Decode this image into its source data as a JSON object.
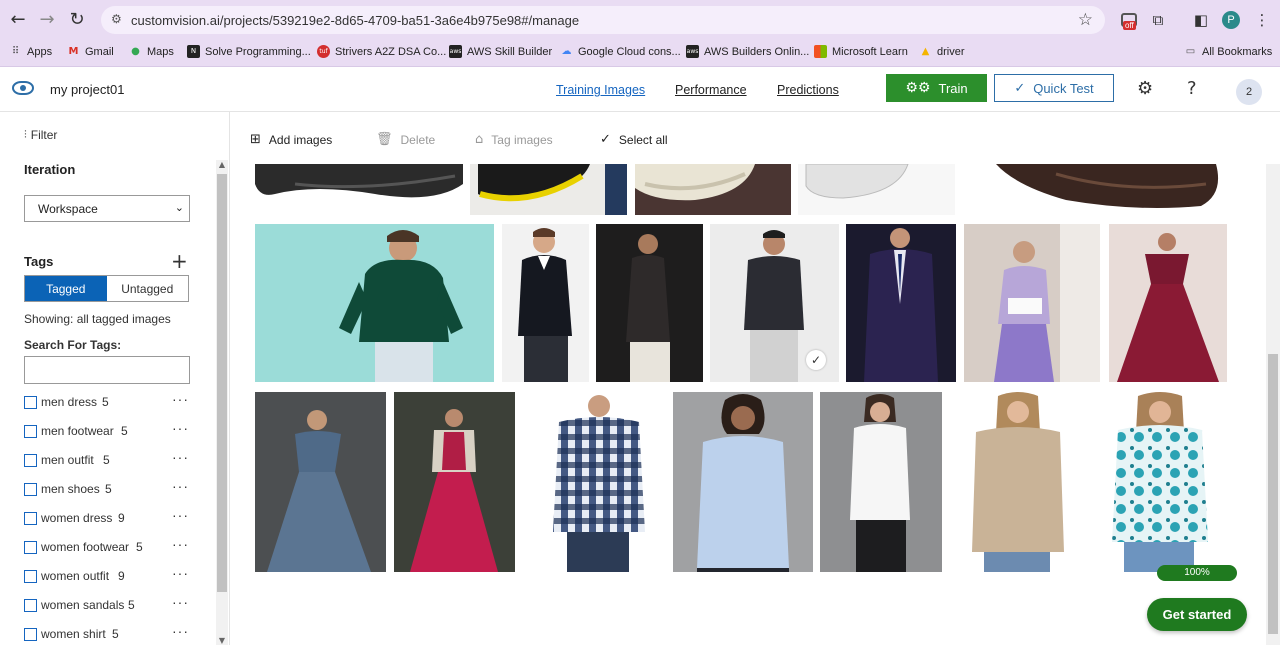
{
  "browser": {
    "url": "customvision.ai/projects/539219e2-8d65-4709-ba51-3a6e4b975e98#/manage",
    "profile_initial": "P",
    "extension_badge": "off",
    "bookmarks": [
      {
        "label": "Apps",
        "icon": "apps-grid-icon"
      },
      {
        "label": "Gmail",
        "icon": "gmail-icon"
      },
      {
        "label": "Maps",
        "icon": "maps-icon"
      },
      {
        "label": "Solve Programming...",
        "icon": "site-icon"
      },
      {
        "label": "Strivers A2Z DSA Co...",
        "icon": "site-icon"
      },
      {
        "label": "AWS Skill Builder",
        "icon": "aws-icon"
      },
      {
        "label": "Google Cloud cons...",
        "icon": "google-cloud-icon"
      },
      {
        "label": "AWS Builders Onlin...",
        "icon": "aws-icon"
      },
      {
        "label": "Microsoft Learn",
        "icon": "microsoft-icon"
      },
      {
        "label": "driver",
        "icon": "drive-icon"
      }
    ],
    "all_bookmarks": "All Bookmarks"
  },
  "header": {
    "project_name": "my project01",
    "tabs": [
      {
        "label": "Training Images",
        "active": true
      },
      {
        "label": "Performance",
        "active": false
      },
      {
        "label": "Predictions",
        "active": false
      }
    ],
    "train_label": "Train",
    "quick_test_label": "Quick Test",
    "help_label": "?",
    "avatar_label": "2"
  },
  "sidebar": {
    "filter_label": "Filter",
    "iteration_label": "Iteration",
    "iteration_value": "Workspace",
    "tags_label": "Tags",
    "tagged_label": "Tagged",
    "untagged_label": "Untagged",
    "showing_text": "Showing: all tagged images",
    "search_label": "Search For Tags:",
    "search_value": "",
    "tags": [
      {
        "name": "men dress",
        "count": "5"
      },
      {
        "name": "men footwear",
        "count": "5"
      },
      {
        "name": "men outfit",
        "count": "5"
      },
      {
        "name": "men shoes",
        "count": "5"
      },
      {
        "name": "women dress",
        "count": "9"
      },
      {
        "name": "women footwear",
        "count": "5"
      },
      {
        "name": "women outfit",
        "count": "9"
      },
      {
        "name": "women sandals",
        "count": "5"
      },
      {
        "name": "women shirt",
        "count": "5"
      }
    ],
    "more_label": "···"
  },
  "toolbar": {
    "add_images": "Add images",
    "delete": "Delete",
    "tag_images": "Tag images",
    "select_all": "Select all"
  },
  "status": {
    "progress": "100%",
    "get_started": "Get started"
  },
  "colors": {
    "accent_blue": "#0b63b6",
    "train_green": "#2c8f2c",
    "status_green": "#1f7a1f"
  }
}
